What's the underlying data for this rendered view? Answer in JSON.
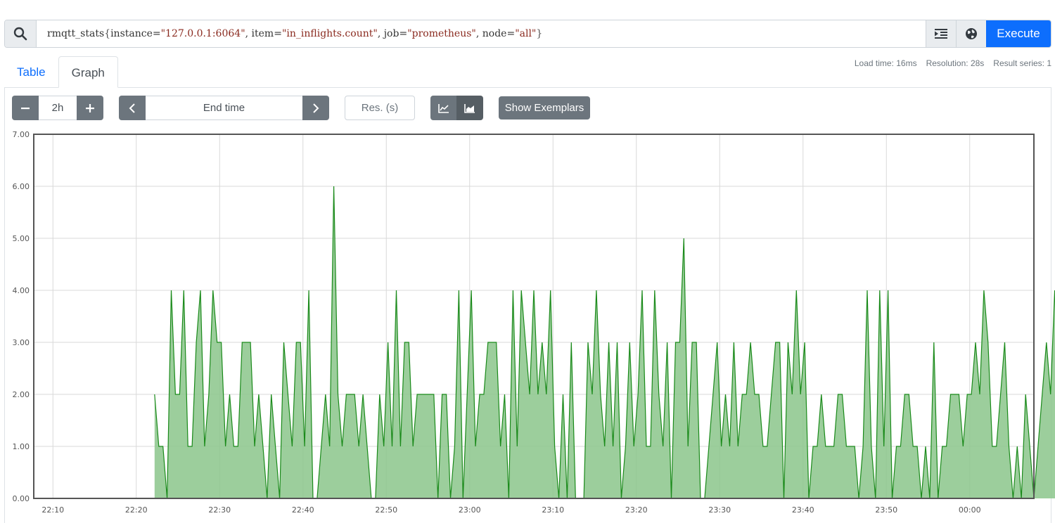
{
  "query": {
    "metric": "rmqtt_stats",
    "labels": [
      {
        "key": "instance",
        "value": "\"127.0.0.1:6064\""
      },
      {
        "key": "item",
        "value": "\"in_inflights.count\""
      },
      {
        "key": "job",
        "value": "\"prometheus\""
      },
      {
        "key": "node",
        "value": "\"all\""
      }
    ],
    "execute_label": "Execute"
  },
  "tabs": [
    {
      "label": "Table",
      "active": false
    },
    {
      "label": "Graph",
      "active": true
    }
  ],
  "stats": {
    "load_time": "Load time: 16ms",
    "resolution": "Resolution: 28s",
    "result_series": "Result series: 1"
  },
  "controls": {
    "range": "2h",
    "end_time_placeholder": "End time",
    "res_placeholder": "Res. (s)",
    "show_exemplars": "Show Exemplars"
  },
  "colors": {
    "accent": "#0d6efd",
    "series_line": "#1a8a1a",
    "series_fill": "#8bc58b"
  },
  "chart_data": {
    "type": "area",
    "x_ticks": [
      "22:10",
      "22:20",
      "22:30",
      "22:40",
      "22:50",
      "23:00",
      "23:10",
      "23:20",
      "23:30",
      "23:40",
      "23:50",
      "00:00"
    ],
    "y_ticks": [
      "0.00",
      "1.00",
      "2.00",
      "3.00",
      "4.00",
      "5.00",
      "6.00",
      "7.00"
    ],
    "ylim": [
      0,
      7
    ],
    "x_range_minutes": [
      -22.3,
      97.7
    ],
    "grid": true,
    "series": [
      {
        "points": [
          [
            -7.8,
            2
          ],
          [
            -7.3,
            1
          ],
          [
            -6.8,
            1
          ],
          [
            -6.3,
            0
          ],
          [
            -5.8,
            4
          ],
          [
            -5.3,
            2
          ],
          [
            -4.8,
            2
          ],
          [
            -4.3,
            4
          ],
          [
            -3.8,
            1
          ],
          [
            -3.3,
            1
          ],
          [
            -2.8,
            3
          ],
          [
            -2.3,
            4
          ],
          [
            -1.8,
            1
          ],
          [
            -1.3,
            2
          ],
          [
            -0.8,
            4
          ],
          [
            -0.3,
            3
          ],
          [
            0.2,
            3
          ],
          [
            0.7,
            1
          ],
          [
            1.2,
            2
          ],
          [
            1.7,
            1
          ],
          [
            2.2,
            1
          ],
          [
            2.7,
            3
          ],
          [
            3.2,
            3
          ],
          [
            3.7,
            3
          ],
          [
            4.2,
            1
          ],
          [
            4.7,
            2
          ],
          [
            5.2,
            1
          ],
          [
            5.7,
            0
          ],
          [
            6.2,
            2
          ],
          [
            6.7,
            1
          ],
          [
            7.2,
            0
          ],
          [
            7.7,
            3
          ],
          [
            8.2,
            2
          ],
          [
            8.7,
            1
          ],
          [
            9.2,
            3
          ],
          [
            9.7,
            3
          ],
          [
            10.2,
            1
          ],
          [
            10.7,
            4
          ],
          [
            11.2,
            0
          ],
          [
            11.7,
            0
          ],
          [
            12.2,
            1
          ],
          [
            12.7,
            2
          ],
          [
            13.2,
            1
          ],
          [
            13.7,
            6
          ],
          [
            14.2,
            2
          ],
          [
            14.7,
            1
          ],
          [
            15.2,
            2
          ],
          [
            15.7,
            2
          ],
          [
            16.2,
            2
          ],
          [
            16.7,
            1
          ],
          [
            17.2,
            2
          ],
          [
            17.7,
            1
          ],
          [
            18.2,
            0
          ],
          [
            18.7,
            0
          ],
          [
            19.2,
            2
          ],
          [
            19.7,
            1
          ],
          [
            20.2,
            3
          ],
          [
            20.7,
            1
          ],
          [
            21.2,
            4
          ],
          [
            21.7,
            1
          ],
          [
            22.2,
            3
          ],
          [
            22.7,
            3
          ],
          [
            23.2,
            1
          ],
          [
            23.7,
            2
          ],
          [
            24.2,
            2
          ],
          [
            24.7,
            2
          ],
          [
            25.2,
            2
          ],
          [
            25.7,
            2
          ],
          [
            26.2,
            0
          ],
          [
            26.7,
            2
          ],
          [
            27.2,
            2
          ],
          [
            27.7,
            0
          ],
          [
            28.2,
            1
          ],
          [
            28.7,
            4
          ],
          [
            29.2,
            0
          ],
          [
            29.7,
            2
          ],
          [
            30.2,
            4
          ],
          [
            30.7,
            1
          ],
          [
            31.2,
            2
          ],
          [
            31.7,
            2
          ],
          [
            32.2,
            3
          ],
          [
            32.7,
            3
          ],
          [
            33.2,
            3
          ],
          [
            33.7,
            1
          ],
          [
            34.2,
            2
          ],
          [
            34.7,
            0
          ],
          [
            35.2,
            4
          ],
          [
            35.7,
            1
          ],
          [
            36.2,
            4
          ],
          [
            36.7,
            3
          ],
          [
            37.2,
            2
          ],
          [
            37.7,
            4
          ],
          [
            38.2,
            2
          ],
          [
            38.7,
            3
          ],
          [
            39.2,
            2
          ],
          [
            39.7,
            4
          ],
          [
            40.2,
            1
          ],
          [
            40.7,
            0
          ],
          [
            41.2,
            2
          ],
          [
            41.7,
            0
          ],
          [
            42.2,
            3
          ],
          [
            42.7,
            0
          ],
          [
            43.2,
            0
          ],
          [
            43.7,
            0
          ],
          [
            44.2,
            3
          ],
          [
            44.7,
            2
          ],
          [
            45.2,
            4
          ],
          [
            45.7,
            2
          ],
          [
            46.2,
            1
          ],
          [
            46.7,
            3
          ],
          [
            47.2,
            1
          ],
          [
            47.7,
            3
          ],
          [
            48.2,
            0
          ],
          [
            48.7,
            1
          ],
          [
            49.2,
            3
          ],
          [
            49.7,
            1
          ],
          [
            50.2,
            2
          ],
          [
            50.7,
            4
          ],
          [
            51.2,
            1
          ],
          [
            51.7,
            1
          ],
          [
            52.2,
            4
          ],
          [
            52.7,
            2
          ],
          [
            53.2,
            1
          ],
          [
            53.7,
            3
          ],
          [
            54.2,
            0
          ],
          [
            54.7,
            3
          ],
          [
            55.2,
            3
          ],
          [
            55.7,
            5
          ],
          [
            56.2,
            1
          ],
          [
            56.7,
            3
          ],
          [
            57.2,
            3
          ],
          [
            57.7,
            0
          ],
          [
            58.2,
            0
          ],
          [
            58.7,
            1
          ],
          [
            59.2,
            2
          ],
          [
            59.7,
            3
          ],
          [
            60.2,
            1
          ],
          [
            60.7,
            2
          ],
          [
            61.2,
            1
          ],
          [
            61.7,
            3
          ],
          [
            62.2,
            1
          ],
          [
            62.7,
            2
          ],
          [
            63.2,
            2
          ],
          [
            63.7,
            3
          ],
          [
            64.2,
            2
          ],
          [
            64.7,
            2
          ],
          [
            65.2,
            1
          ],
          [
            65.7,
            1
          ],
          [
            66.2,
            2
          ],
          [
            66.7,
            3
          ],
          [
            67.2,
            3
          ],
          [
            67.7,
            0
          ],
          [
            68.2,
            3
          ],
          [
            68.7,
            2
          ],
          [
            69.2,
            4
          ],
          [
            69.7,
            2
          ],
          [
            70.2,
            3
          ],
          [
            70.7,
            0
          ],
          [
            71.2,
            1
          ],
          [
            71.7,
            1
          ],
          [
            72.2,
            2
          ],
          [
            72.7,
            1
          ],
          [
            73.2,
            1
          ],
          [
            73.7,
            1
          ],
          [
            74.2,
            2
          ],
          [
            74.7,
            2
          ],
          [
            75.2,
            1
          ],
          [
            75.7,
            1
          ],
          [
            76.2,
            1
          ],
          [
            76.7,
            0
          ],
          [
            77.2,
            1
          ],
          [
            77.7,
            4
          ],
          [
            78.2,
            1
          ],
          [
            78.7,
            0
          ],
          [
            79.2,
            4
          ],
          [
            79.7,
            1
          ],
          [
            80.2,
            4
          ],
          [
            80.7,
            0
          ],
          [
            81.2,
            1
          ],
          [
            81.7,
            1
          ],
          [
            82.2,
            2
          ],
          [
            82.7,
            2
          ],
          [
            83.2,
            1
          ],
          [
            83.7,
            1
          ],
          [
            84.2,
            0
          ],
          [
            84.7,
            1
          ],
          [
            85.2,
            0
          ],
          [
            85.7,
            3
          ],
          [
            86.2,
            0
          ],
          [
            86.7,
            1
          ],
          [
            87.2,
            1
          ],
          [
            87.7,
            2
          ],
          [
            88.2,
            2
          ],
          [
            88.7,
            2
          ],
          [
            89.2,
            1
          ],
          [
            89.7,
            2
          ],
          [
            90.2,
            2
          ],
          [
            90.7,
            3
          ],
          [
            91.2,
            2
          ],
          [
            91.7,
            4
          ],
          [
            92.2,
            3
          ],
          [
            92.7,
            1
          ],
          [
            93.2,
            1
          ],
          [
            93.7,
            2
          ],
          [
            94.2,
            3
          ],
          [
            94.7,
            1
          ],
          [
            95.2,
            0
          ],
          [
            95.7,
            1
          ],
          [
            96.2,
            0
          ],
          [
            96.7,
            2
          ],
          [
            97.2,
            1
          ],
          [
            97.7,
            0
          ],
          [
            98.2,
            1
          ],
          [
            98.7,
            2
          ],
          [
            99.2,
            3
          ],
          [
            99.7,
            2
          ],
          [
            100.2,
            4
          ],
          [
            100.7,
            2
          ],
          [
            101.2,
            2
          ],
          [
            101.7,
            2
          ],
          [
            102.2,
            1
          ],
          [
            102.7,
            2
          ],
          [
            103.2,
            2
          ],
          [
            103.7,
            1
          ],
          [
            104.2,
            1
          ],
          [
            104.7,
            1
          ],
          [
            105.2,
            2
          ]
        ]
      }
    ]
  }
}
